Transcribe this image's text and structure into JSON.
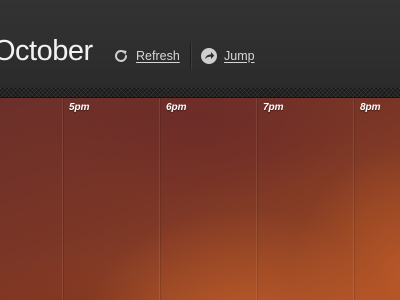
{
  "header": {
    "month": "October",
    "actions": {
      "refresh": {
        "label": "Refresh",
        "icon": "refresh-icon"
      },
      "jump": {
        "label": "Jump",
        "icon": "jump-arrow-icon"
      }
    }
  },
  "timeline": {
    "hours": [
      "5pm",
      "6pm",
      "7pm",
      "8pm"
    ]
  },
  "colors": {
    "header_bg": "#2e2e2e",
    "text": "#f2f2f2",
    "link": "#d6d6d6",
    "timeline_warm": "#a14c26"
  }
}
